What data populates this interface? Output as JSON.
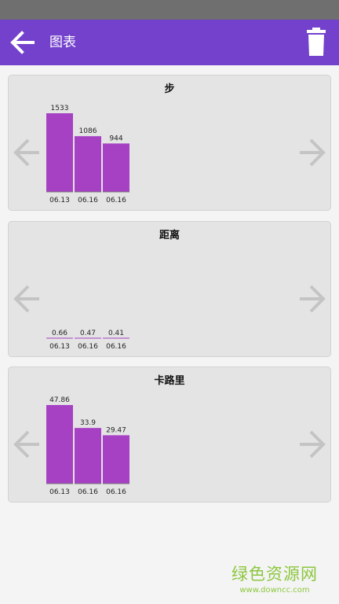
{
  "app_bar": {
    "title": "图表",
    "back_icon": "arrow-left-icon",
    "delete_icon": "trash-icon",
    "color": "#7341cc"
  },
  "watermark": {
    "text": "绿色资源网",
    "url": "www.downcc.com"
  },
  "chart_data": [
    {
      "type": "bar",
      "title": "步",
      "categories": [
        "06.13",
        "06.16",
        "06.16"
      ],
      "values": [
        1533,
        1086,
        944
      ],
      "value_labels": [
        "1533",
        "1086",
        "944"
      ],
      "color": "#a741c4"
    },
    {
      "type": "bar",
      "title": "距离",
      "categories": [
        "06.13",
        "06.16",
        "06.16"
      ],
      "values": [
        0.66,
        0.47,
        0.41
      ],
      "value_labels": [
        "0.66",
        "0.47",
        "0.41"
      ],
      "color": "#a741c4"
    },
    {
      "type": "bar",
      "title": "卡路里",
      "categories": [
        "06.13",
        "06.16",
        "06.16"
      ],
      "values": [
        47.86,
        33.9,
        29.47
      ],
      "value_labels": [
        "47.86",
        "33.9",
        "29.47"
      ],
      "color": "#a741c4"
    }
  ]
}
